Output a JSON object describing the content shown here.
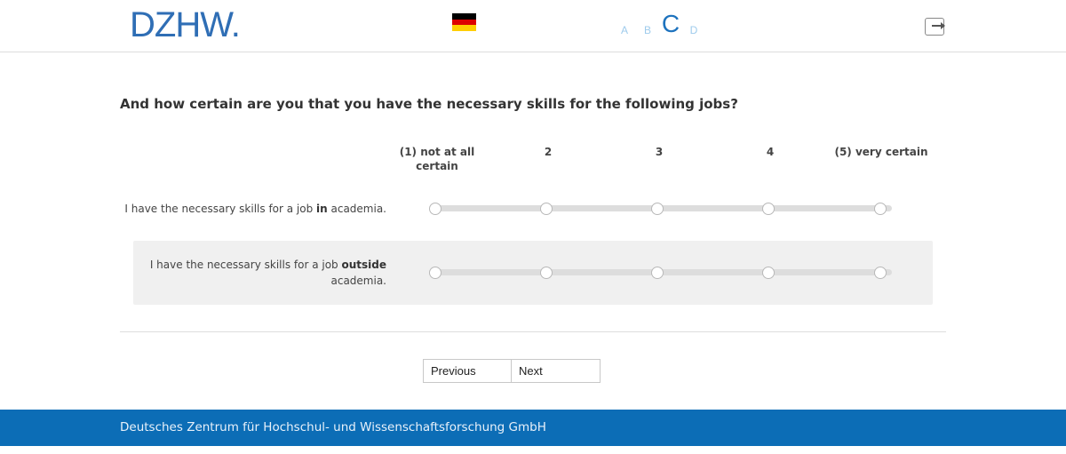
{
  "header": {
    "logo_text": "DZHW",
    "logo_dot": ".",
    "font_size_options": [
      "A",
      "B",
      "C",
      "D"
    ],
    "selected_font_size": "C",
    "language_flag": "german-flag",
    "logout_icon": "logout-icon"
  },
  "question": {
    "text": "And how certain are you that you have the necessary skills for the following jobs?",
    "scale_labels": [
      "(1) not at all certain",
      "2",
      "3",
      "4",
      "(5) very certain"
    ],
    "items": [
      {
        "prefix": "I have the necessary skills for a job ",
        "bold": "in",
        "suffix": " academia."
      },
      {
        "prefix": "I have the necessary skills for a job ",
        "bold": "outside",
        "suffix": " academia."
      }
    ]
  },
  "navigation": {
    "previous_label": "Previous",
    "next_label": "Next"
  },
  "footer": {
    "text": "Deutsches Zentrum für Hochschul- und Wissenschaftsforschung GmbH"
  },
  "colors": {
    "brand_blue": "#2f6eb5",
    "footer_blue": "#0c6db6",
    "font_size_inactive": "#9ecbec"
  }
}
